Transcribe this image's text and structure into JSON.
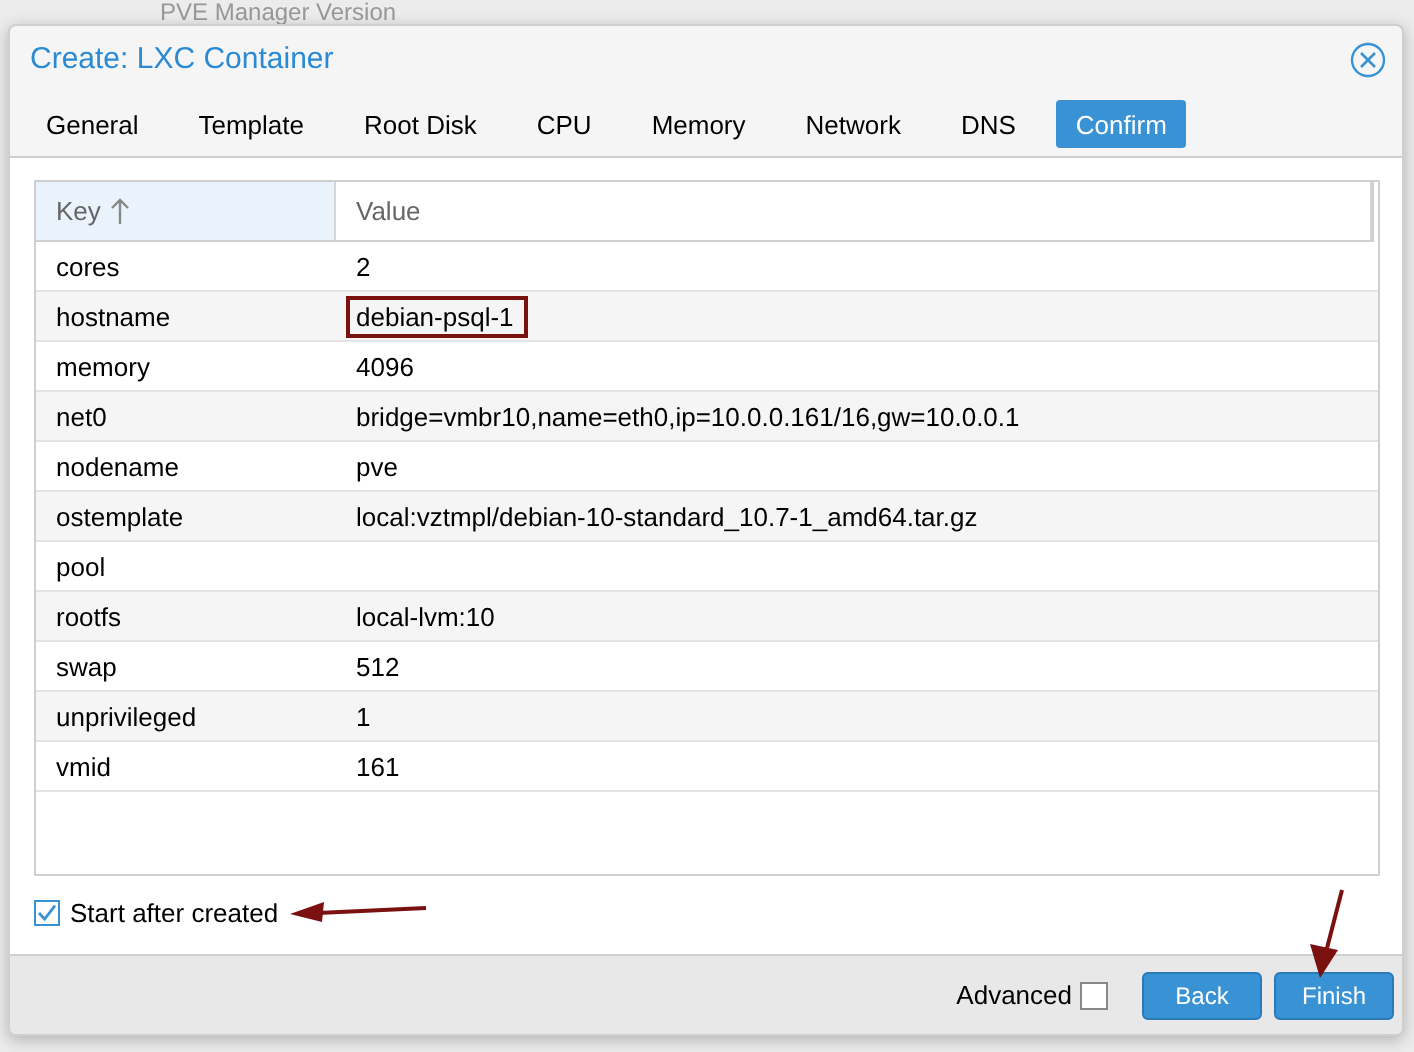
{
  "background": {
    "text": "PVE Manager Version"
  },
  "window": {
    "title": "Create: LXC Container"
  },
  "tabs": [
    {
      "label": "General",
      "selected": false
    },
    {
      "label": "Template",
      "selected": false
    },
    {
      "label": "Root Disk",
      "selected": false
    },
    {
      "label": "CPU",
      "selected": false
    },
    {
      "label": "Memory",
      "selected": false
    },
    {
      "label": "Network",
      "selected": false
    },
    {
      "label": "DNS",
      "selected": false
    },
    {
      "label": "Confirm",
      "selected": true
    }
  ],
  "table": {
    "columns": [
      {
        "label": "Key",
        "sorted": true
      },
      {
        "label": "Value",
        "sorted": false
      }
    ],
    "rows": [
      {
        "key": "cores",
        "value": "2",
        "highlighted": false
      },
      {
        "key": "hostname",
        "value": "debian-psql-1",
        "highlighted": true
      },
      {
        "key": "memory",
        "value": "4096",
        "highlighted": false
      },
      {
        "key": "net0",
        "value": "bridge=vmbr10,name=eth0,ip=10.0.0.161/16,gw=10.0.0.1",
        "highlighted": false
      },
      {
        "key": "nodename",
        "value": "pve",
        "highlighted": false
      },
      {
        "key": "ostemplate",
        "value": "local:vztmpl/debian-10-standard_10.7-1_amd64.tar.gz",
        "highlighted": false
      },
      {
        "key": "pool",
        "value": "",
        "highlighted": false
      },
      {
        "key": "rootfs",
        "value": "local-lvm:10",
        "highlighted": false
      },
      {
        "key": "swap",
        "value": "512",
        "highlighted": false
      },
      {
        "key": "unprivileged",
        "value": "1",
        "highlighted": false
      },
      {
        "key": "vmid",
        "value": "161",
        "highlighted": false
      }
    ]
  },
  "start_after_created": {
    "label": "Start after created",
    "checked": true,
    "annotated": true
  },
  "advanced": {
    "label": "Advanced",
    "checked": false
  },
  "buttons": [
    {
      "label": "Back",
      "annotated": false
    },
    {
      "label": "Finish",
      "annotated": true
    }
  ]
}
